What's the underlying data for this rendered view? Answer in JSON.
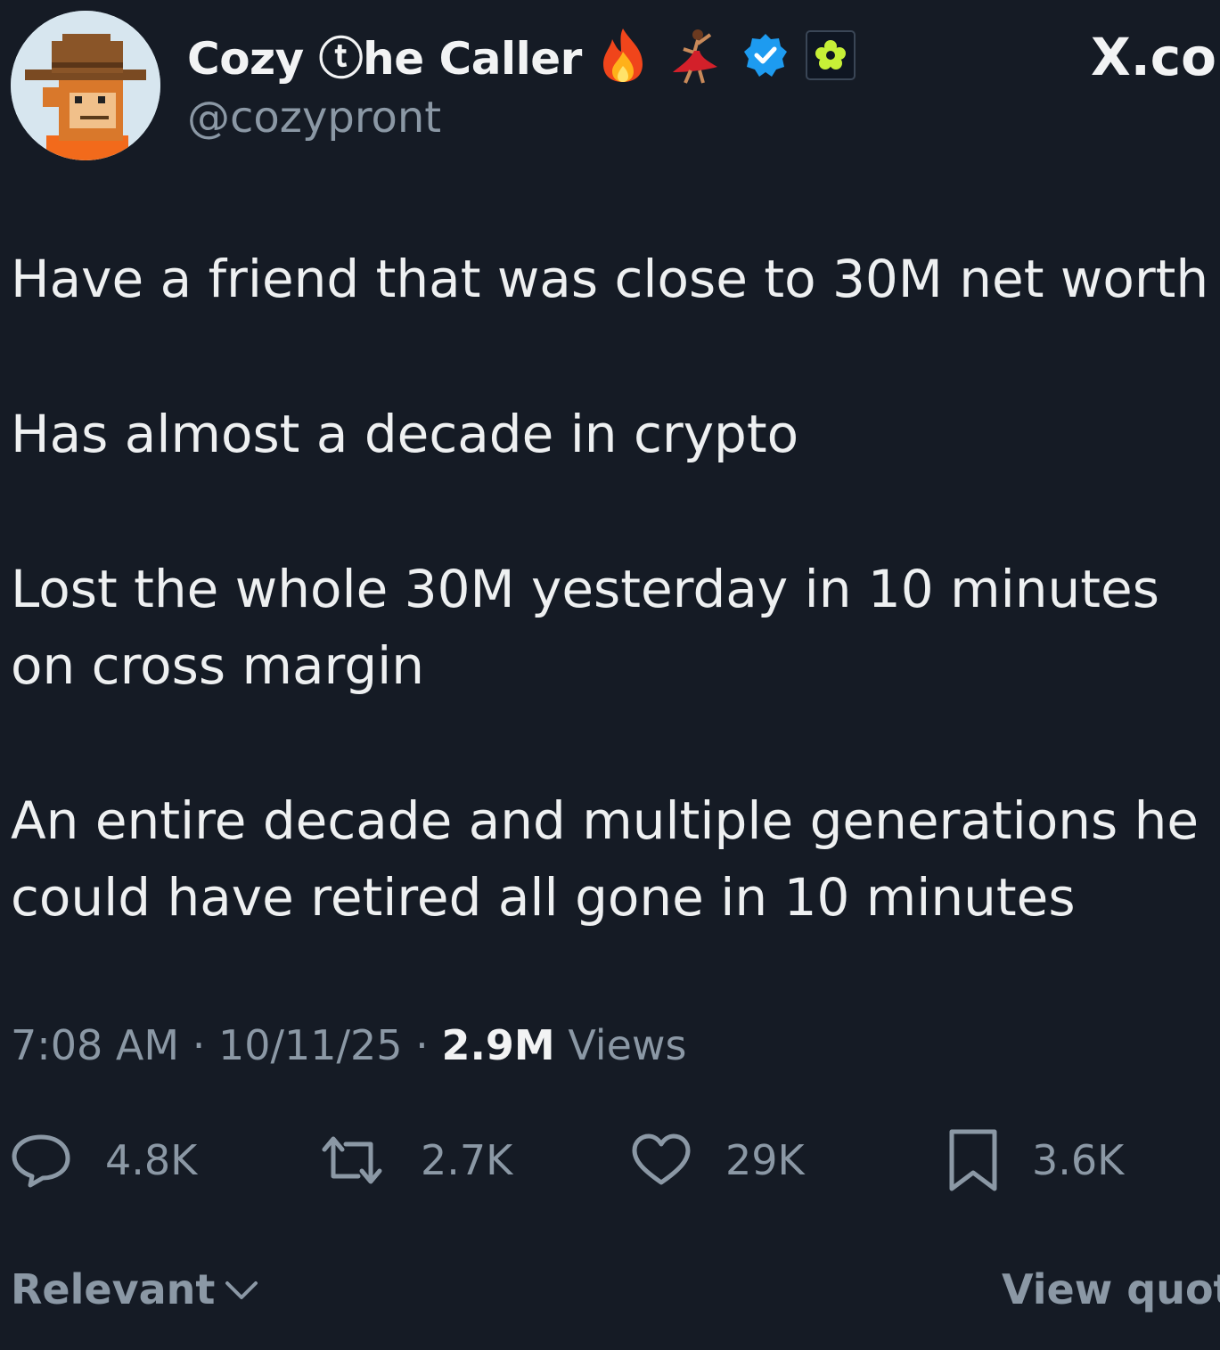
{
  "author": {
    "display_name": "Cozy ⓣhe Caller",
    "handle": "@cozypront",
    "avatar_icon": "pixel-cowboy-ape-avatar",
    "badges": [
      "fire-emoji-icon",
      "dancer-emoji-icon",
      "verified-icon",
      "affiliate-badge-icon"
    ]
  },
  "site_mark": "X.co",
  "post": {
    "paragraphs": [
      "Have a friend that was close to 30M net worth",
      "Has almost a decade in crypto",
      "Lost the whole 30M yesterday in 10 minutes on cross margin",
      "An entire decade and multiple generations he could have retired all gone in 10 minutes"
    ]
  },
  "meta": {
    "time": "7:08 AM",
    "sep1": " · ",
    "date": "10/11/25",
    "sep2": " · ",
    "views_count": "2.9M",
    "views_label": " Views"
  },
  "actions": {
    "replies": "4.8K",
    "reposts": "2.7K",
    "likes": "29K",
    "bookmarks": "3.6K"
  },
  "footer": {
    "sort_label": "Relevant",
    "view_quotes": "View quot"
  },
  "colors": {
    "background": "#151b25",
    "text": "#e7e9ea",
    "muted": "#8b98a5",
    "verified": "#1d9bf0"
  }
}
